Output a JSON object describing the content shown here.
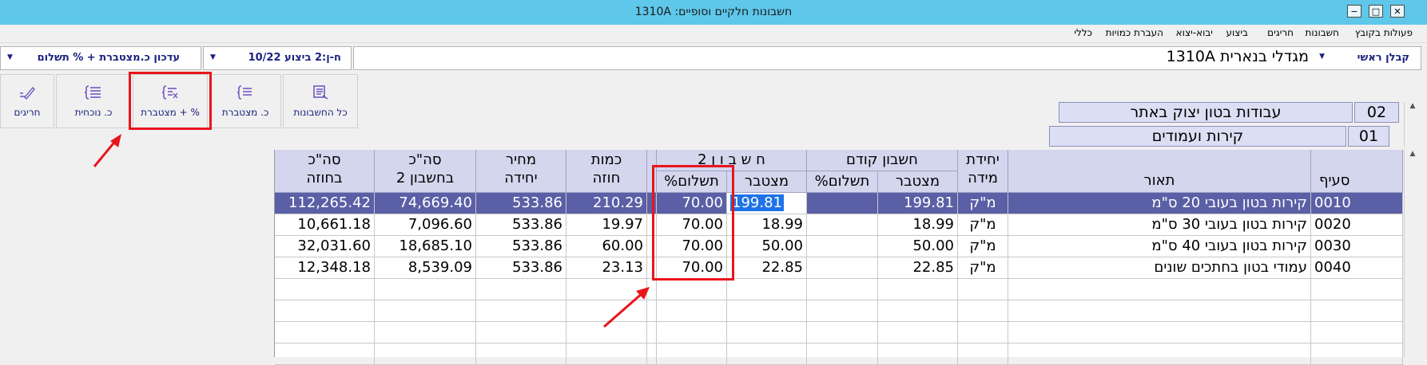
{
  "window": {
    "title": "1310A :חשבונות חלקיים וסופיים",
    "minimize": "−",
    "maximize": "□",
    "close": "✕"
  },
  "menu": [
    "פעולות בקובץ",
    "חשבונות",
    "חריגים",
    "ביצוע",
    "יבוא-יצוא",
    "העברת כמויות",
    "כללי"
  ],
  "selectors": {
    "contractor_label": "קבלן ראשי",
    "project": "1310A  מגדלי בנארית",
    "bill": "ח-ן:2 ביצוע 10/22",
    "update": "עדכון כ.מצטברת + % תשלום"
  },
  "toolbar": [
    {
      "label": "כל החשבונות",
      "icon": "all-bills-icon"
    },
    {
      "label": "כ. מצטברת",
      "icon": "cumulative-icon"
    },
    {
      "label": "מצטברת + %",
      "icon": "cumulative-percent-icon"
    },
    {
      "label": "כ. נוכחית",
      "icon": "current-qty-icon"
    },
    {
      "label": "חריגים",
      "icon": "exceptions-icon"
    }
  ],
  "categories": [
    {
      "code": "02",
      "name": "עבודות בטון יצוק באתר"
    },
    {
      "code": "01",
      "name": "קירות ועמודים"
    }
  ],
  "grid": {
    "headers": {
      "section": "סעיף",
      "description": "תאור",
      "unit_top": "יחידת",
      "unit_bottom": "מידה",
      "prev_bill": "חשבון קודם",
      "prev_cumulative": "מצטבר",
      "prev_pay": "%תשלום",
      "bill2": "ח ש ב ו ן  2",
      "bill2_cumulative": "מצטבר",
      "bill2_pay": "%תשלום",
      "qty_top": "כמות",
      "qty_bottom": "חוזה",
      "price_top": "מחיר",
      "price_bottom": "יחידה",
      "total_bill_top": "סה\"כ",
      "total_bill_bottom": "בחשבון 2",
      "total_contract_top": "סה\"כ",
      "total_contract_bottom": "בחוזה"
    },
    "rows": [
      {
        "section": "0010",
        "description": "קירות בטון בעובי 20 ס\"מ",
        "unit": "מ\"ק",
        "prev_cumulative": "199.81",
        "prev_pay": "",
        "cumulative": "199.81",
        "pay": "70.00",
        "qty": "210.29",
        "price": "533.86",
        "total_bill": "74,669.40",
        "total_contract": "112,265.42"
      },
      {
        "section": "0020",
        "description": "קירות בטון בעובי 30 ס\"מ",
        "unit": "מ\"ק",
        "prev_cumulative": "18.99",
        "prev_pay": "",
        "cumulative": "18.99",
        "pay": "70.00",
        "qty": "19.97",
        "price": "533.86",
        "total_bill": "7,096.60",
        "total_contract": "10,661.18"
      },
      {
        "section": "0030",
        "description": "קירות בטון בעובי 40 ס\"מ",
        "unit": "מ\"ק",
        "prev_cumulative": "50.00",
        "prev_pay": "",
        "cumulative": "50.00",
        "pay": "70.00",
        "qty": "60.00",
        "price": "533.86",
        "total_bill": "18,685.10",
        "total_contract": "32,031.60"
      },
      {
        "section": "0040",
        "description": "עמודי בטון בחתכים שונים",
        "unit": "מ\"ק",
        "prev_cumulative": "22.85",
        "prev_pay": "",
        "cumulative": "22.85",
        "pay": "70.00",
        "qty": "23.13",
        "price": "533.86",
        "total_bill": "8,539.09",
        "total_contract": "12,348.18"
      }
    ]
  },
  "colors": {
    "titlebar": "#5ec7ea",
    "selected_row": "#5b5fa6",
    "header": "#d4d6ee",
    "highlight_border": "#e8151c"
  }
}
